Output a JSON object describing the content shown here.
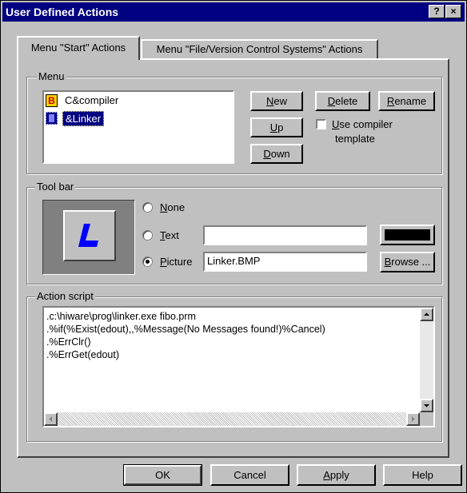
{
  "window": {
    "title": "User Defined Actions",
    "help_label": "?",
    "close_label": "×"
  },
  "tabs": [
    {
      "label": "Menu \"Start\" Actions"
    },
    {
      "label": "Menu \"File/Version Control Systems\" Actions"
    }
  ],
  "menu": {
    "group_label": "Menu",
    "items": [
      {
        "label": "C&compiler",
        "icon": "b-icon"
      },
      {
        "label": "&Linker",
        "icon": "linker-icon"
      }
    ],
    "buttons": {
      "new": {
        "pre": "",
        "u": "N",
        "post": "ew"
      },
      "delete": {
        "pre": "",
        "u": "D",
        "post": "elete"
      },
      "rename": {
        "pre": "",
        "u": "R",
        "post": "ename"
      },
      "up": {
        "pre": "",
        "u": "U",
        "post": "p"
      },
      "down": {
        "pre": "",
        "u": "D",
        "post": "own"
      }
    },
    "use_template": {
      "u": "U",
      "line1": "se compiler",
      "line2": "template",
      "checked": false
    }
  },
  "toolbar": {
    "group_label": "Tool bar",
    "none": {
      "u": "N",
      "post": "one"
    },
    "text": {
      "u": "T",
      "post": "ext",
      "value": ""
    },
    "picture": {
      "u": "P",
      "post": "icture",
      "value": "Linker.BMP"
    },
    "browse": {
      "u": "B",
      "post": "rowse ..."
    },
    "selected": "picture",
    "color_swatch": "#000000"
  },
  "script": {
    "group_label": "Action script",
    "lines": [
      ".c:\\hiware\\prog\\linker.exe fibo.prm",
      ".%if(%Exist(edout),,%Message(No Messages found!)%Cancel)",
      ".%ErrClr()",
      ".%ErrGet(edout)"
    ]
  },
  "footer": {
    "ok": "OK",
    "cancel": "Cancel",
    "apply": {
      "u": "A",
      "post": "pply"
    },
    "help": "Help"
  }
}
